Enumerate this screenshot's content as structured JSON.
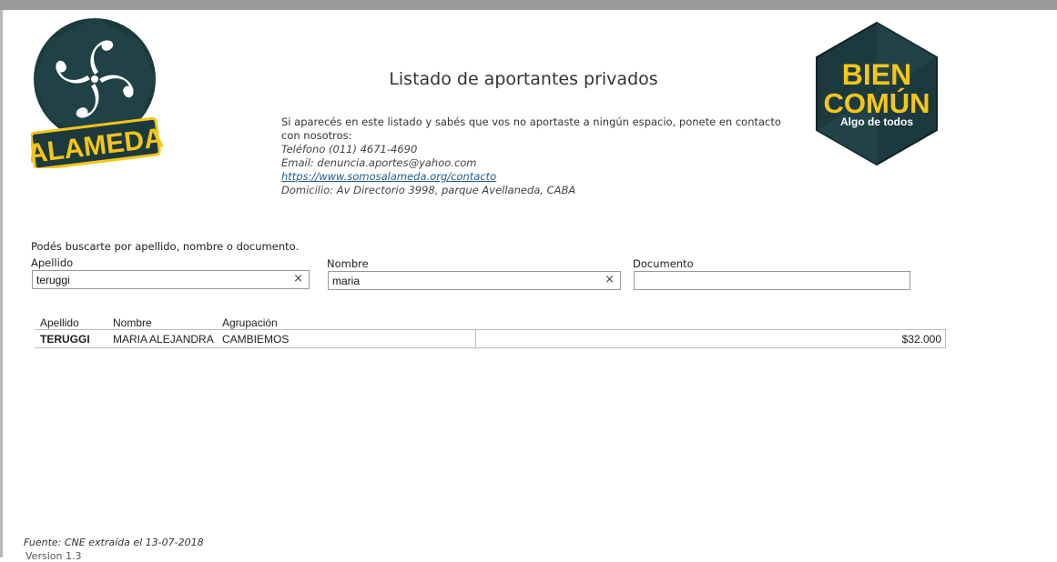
{
  "title": "Listado de aportantes privados",
  "info": {
    "intro": "Si aparecés en este listado y sabés que vos no aportaste a ningún espacio, ponete en contacto con nosotros:",
    "phone": "Teléfono (011) 4671-4690",
    "email": "Email: denuncia.aportes@yahoo.com",
    "link": "https://www.somosalameda.org/contacto",
    "address": "Domicilio: Av Directorio 3998, parque Avellaneda, CABA"
  },
  "logos": {
    "left": {
      "text": "ALAMEDA",
      "icon": "alameda-pinwheel-icon",
      "color_bg": "#1c3a3e",
      "color_text": "#f5c518"
    },
    "right": {
      "line1": "BIEN",
      "line2": "COMÚN",
      "line3": "Algo de todos",
      "color_bg": "#1c3a3e",
      "color_text": "#f5c518"
    }
  },
  "search": {
    "hint": "Podés buscarte por apellido, nombre o documento.",
    "apellido": {
      "label": "Apellido",
      "value": "teruggi"
    },
    "nombre": {
      "label": "Nombre",
      "value": "maria"
    },
    "documento": {
      "label": "Documento",
      "value": ""
    },
    "clear_glyph": "×"
  },
  "table": {
    "headers": [
      "Apellido",
      "Nombre",
      "Agrupación"
    ],
    "rows": [
      {
        "apellido": "TERUGGI",
        "nombre": "MARIA ALEJANDRA",
        "agrupacion": "CAMBIEMOS",
        "monto": "$32.000"
      }
    ]
  },
  "footer": {
    "source": "Fuente: CNE extraída el 13-07-2018",
    "version": "Version 1.3"
  }
}
